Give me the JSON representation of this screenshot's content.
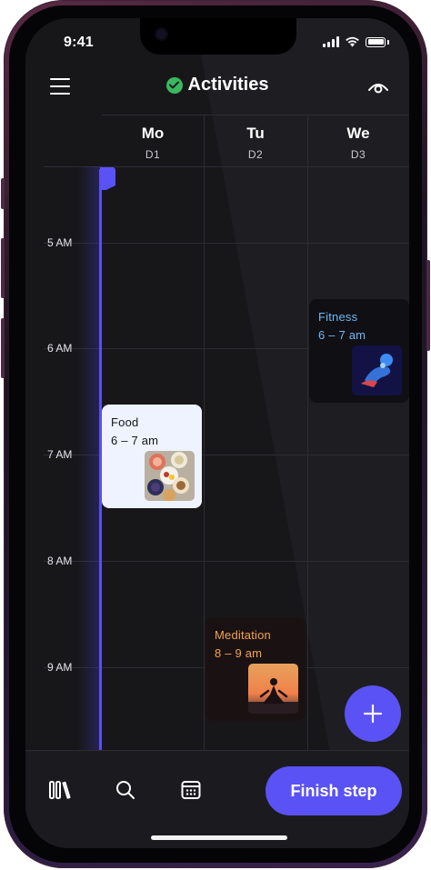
{
  "status": {
    "time": "9:41"
  },
  "header": {
    "title": "Activities"
  },
  "days": [
    {
      "name": "Mo",
      "sub": "D1"
    },
    {
      "name": "Tu",
      "sub": "D2"
    },
    {
      "name": "We",
      "sub": "D3"
    }
  ],
  "hours": [
    "5 AM",
    "6 AM",
    "7 AM",
    "8 AM",
    "9 AM"
  ],
  "events": {
    "food": {
      "title": "Food",
      "time": "6 – 7 am",
      "image": "food-bowls-photo"
    },
    "fitness": {
      "title": "Fitness",
      "time": "6 – 7 am",
      "image": "fitness-athlete-photo"
    },
    "meditation": {
      "title": "Meditation",
      "time": "8 – 9 am",
      "image": "meditation-sunset-photo"
    }
  },
  "actions": {
    "finish_label": "Finish step",
    "add_icon": "plus-icon"
  },
  "nav": {
    "icons": [
      "library-icon",
      "search-icon",
      "calendar-icon"
    ]
  },
  "colors": {
    "accent": "#5a52f5",
    "background": "#1e1e22",
    "food_card": "#eef3ff",
    "fitness_text": "#6fb7f2",
    "meditation_text": "#f2a253",
    "check_green": "#3bb85e"
  }
}
